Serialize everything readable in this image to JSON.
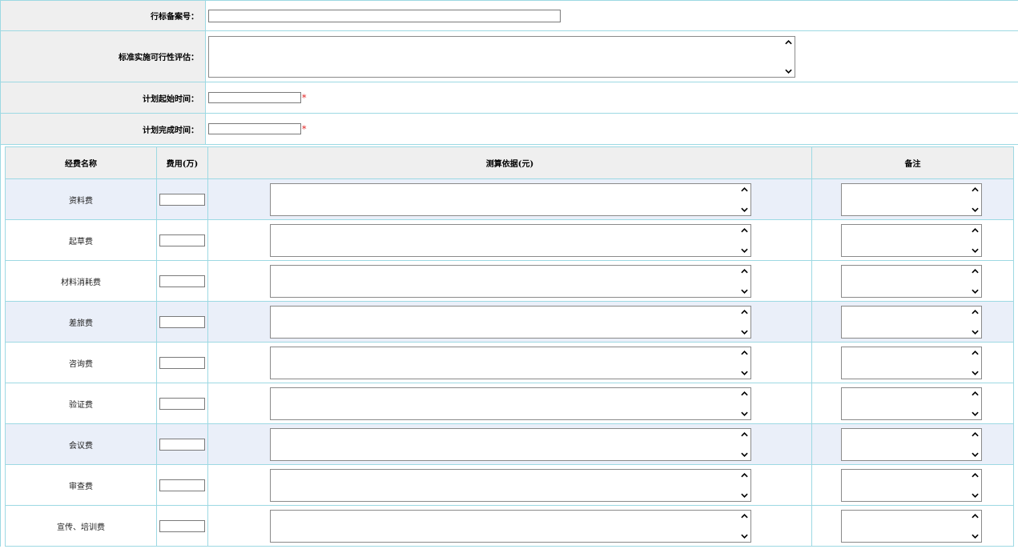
{
  "form": {
    "record_number_label": "行标备案号：",
    "record_number_value": "",
    "feasibility_label": "标准实施可行性评估：",
    "feasibility_value": "",
    "plan_start_label": "计划起始时间：",
    "plan_start_value": "",
    "plan_end_label": "计划完成时间：",
    "plan_end_value": "",
    "required_mark": "*"
  },
  "budget": {
    "headers": {
      "name": "经费名称",
      "fee": "费用(万)",
      "basis": "测算依据(元)",
      "remark": "备注"
    },
    "rows": [
      {
        "name": "资料费"
      },
      {
        "name": "起草费"
      },
      {
        "name": "材料消耗费"
      },
      {
        "name": "差旅费"
      },
      {
        "name": "咨询费"
      },
      {
        "name": "验证费"
      },
      {
        "name": "会议费"
      },
      {
        "name": "审查费"
      },
      {
        "name": "宣传、培训费"
      }
    ]
  },
  "icons": {
    "scroll_up": "chevron-up-icon",
    "scroll_down": "chevron-down-icon"
  },
  "colors": {
    "border": "#9dd9e3",
    "label_bg": "#efefef",
    "alt_row_bg": "#eaeff9",
    "required": "#e02020"
  }
}
